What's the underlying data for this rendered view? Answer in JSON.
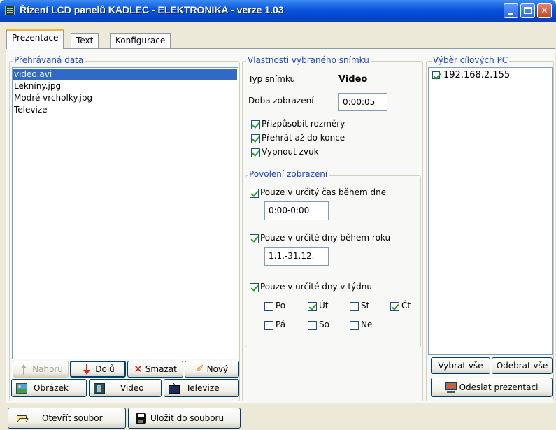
{
  "window": {
    "title": "Řízení LCD panelů KADLEC - ELEKTRONIKA  - verze 1.03"
  },
  "tabs": [
    "Prezentace",
    "Text",
    "Konfigurace"
  ],
  "playlist": {
    "legend": "Přehrávaná data",
    "items": [
      "video.avi",
      "Lekníny.jpg",
      "Modré vrcholky.jpg",
      "Televize"
    ],
    "selected": "video.avi",
    "buttons": {
      "up": "Nahoru",
      "down": "Dolů",
      "delete": "Smazat",
      "new": "Nový"
    },
    "add_buttons": {
      "image": "Obrázek",
      "video": "Video",
      "tv": "Televize"
    }
  },
  "properties": {
    "legend": "Vlastnosti vybraného snímku",
    "type_label": "Typ snímku",
    "type_value": "Video",
    "duration_label": "Doba zobrazení",
    "duration_value": "0:00:05",
    "fit_size": "Přizpůsobit rozměry",
    "play_to_end": "Přehrát až do konce",
    "mute": "Vypnout zvuk",
    "permission": {
      "legend": "Povolení zobrazení",
      "time_of_day": "Pouze v určitý čas během dne",
      "time_value": "0:00-0:00",
      "days_of_year": "Pouze v určité dny během roku",
      "date_value": "1.1.-31.12.",
      "days_of_week": "Pouze v určité dny v týdnu",
      "days": [
        {
          "label": "Po",
          "checked": false
        },
        {
          "label": "Út",
          "checked": true
        },
        {
          "label": "St",
          "checked": false
        },
        {
          "label": "Čt",
          "checked": true
        },
        {
          "label": "Pá",
          "checked": false
        },
        {
          "label": "So",
          "checked": false
        },
        {
          "label": "Ne",
          "checked": false
        }
      ]
    }
  },
  "targets": {
    "legend": "Výběr cílových PC",
    "items": [
      {
        "label": "192.168.2.155",
        "checked": true
      }
    ],
    "select_all": "Vybrat vše",
    "deselect_all": "Odebrat vše",
    "send": "Odeslat prezentaci"
  },
  "footer": {
    "open": "Otevřít soubor",
    "save": "Uložit do souboru"
  },
  "colors": {
    "title_bar": "#0a55dc",
    "selection": "#316ac5",
    "legend_text": "#1c45c8",
    "tab_accent": "#f5b33d"
  }
}
